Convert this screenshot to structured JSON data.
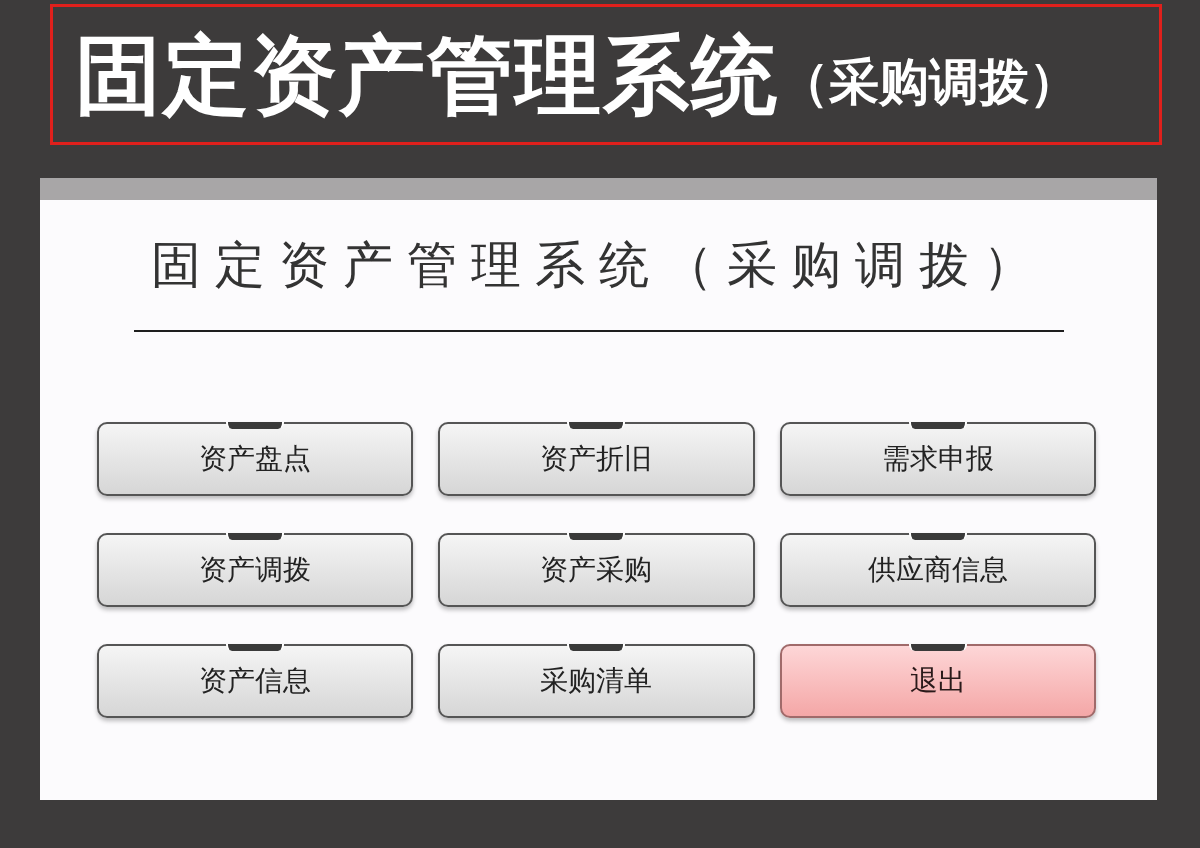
{
  "banner": {
    "title": "固定资产管理系统",
    "subtitle": "（采购调拨）"
  },
  "window": {
    "title": "固定资产管理系统（采购调拨）"
  },
  "buttons": [
    {
      "label": "资产盘点",
      "kind": "default"
    },
    {
      "label": "资产折旧",
      "kind": "default"
    },
    {
      "label": "需求申报",
      "kind": "default"
    },
    {
      "label": "资产调拨",
      "kind": "default"
    },
    {
      "label": "资产采购",
      "kind": "default"
    },
    {
      "label": "供应商信息",
      "kind": "default"
    },
    {
      "label": "资产信息",
      "kind": "default"
    },
    {
      "label": "采购清单",
      "kind": "default"
    },
    {
      "label": "退出",
      "kind": "danger"
    }
  ]
}
